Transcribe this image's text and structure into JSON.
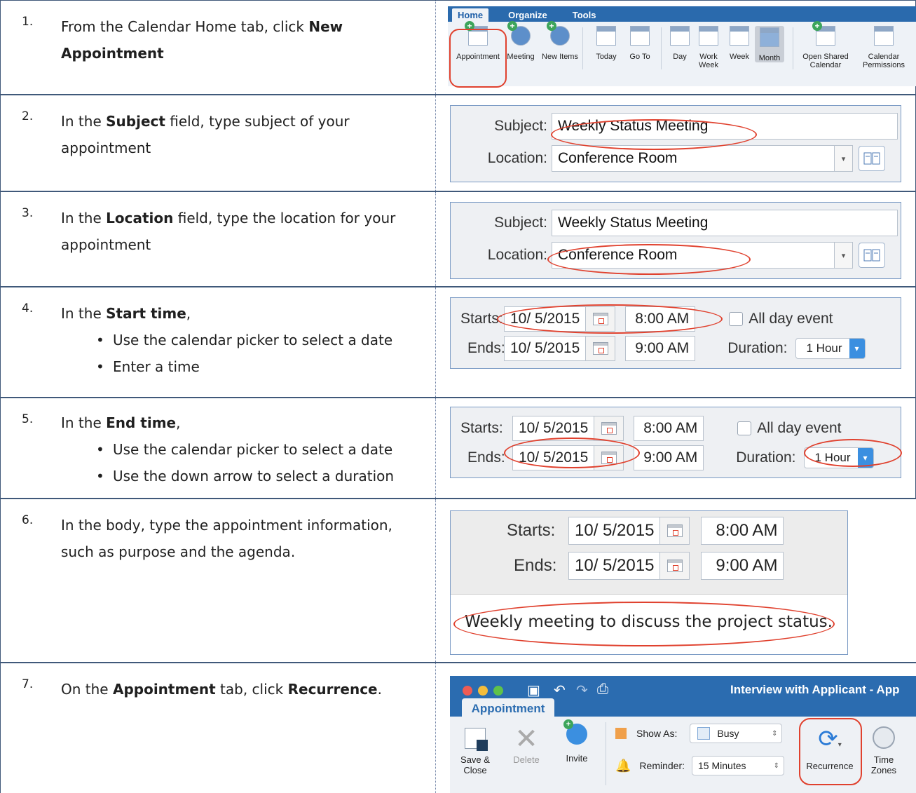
{
  "steps": [
    {
      "num": "1.",
      "pre": "From the Calendar Home tab, click ",
      "bold": "New Appointment",
      "post": ""
    },
    {
      "num": "2.",
      "pre": "In the ",
      "bold": "Subject",
      "post": " field, type subject of your appointment"
    },
    {
      "num": "3.",
      "pre": "In the ",
      "bold": "Location",
      "post": " field, type the location for your appointment"
    },
    {
      "num": "4.",
      "pre": "In the ",
      "bold": "Start time",
      "post": ",",
      "bullets": [
        "Use the calendar picker to select a date",
        "Enter a time"
      ]
    },
    {
      "num": "5.",
      "pre": "In the ",
      "bold": "End time",
      "post": ",",
      "bullets": [
        "Use the calendar picker to select a date",
        "Use the down arrow to select a duration"
      ]
    },
    {
      "num": "6.",
      "pre": "In the body, type the appointment information, such as purpose and the agenda.",
      "bold": "",
      "post": ""
    },
    {
      "num": "7.",
      "pre": "On the ",
      "bold": "Appointment",
      "mid": " tab, click ",
      "bold2": "Recurrence",
      "post": "."
    }
  ],
  "ribbon": {
    "tabs": [
      "Home",
      "Organize",
      "Tools"
    ],
    "buttons": [
      "Appointment",
      "Meeting",
      "New Items",
      "Today",
      "Go To",
      "Day",
      "Work Week",
      "Week",
      "Month",
      "Open Shared Calendar",
      "Calendar Permissions"
    ]
  },
  "form": {
    "subject_label": "Subject:",
    "subject_value": "Weekly Status Meeting",
    "location_label": "Location:",
    "location_value": "Conference Room"
  },
  "times": {
    "starts_label": "Starts:",
    "ends_label": "Ends:",
    "start_date": "10/ 5/2015",
    "end_date": "10/ 5/2015",
    "start_time": "8:00 AM",
    "end_time": "9:00 AM",
    "all_day": "All day event",
    "duration_label": "Duration:",
    "duration_value": "1 Hour"
  },
  "body_text": "Weekly meeting to discuss the project status.",
  "appointment_window": {
    "title": "Interview with Applicant - App",
    "tab": "Appointment",
    "save_close": "Save & Close",
    "delete": "Delete",
    "invite": "Invite",
    "show_as_label": "Show As:",
    "show_as_value": "Busy",
    "reminder_label": "Reminder:",
    "reminder_value": "15 Minutes",
    "recurrence": "Recurrence",
    "time_zones": "Time Zones"
  }
}
